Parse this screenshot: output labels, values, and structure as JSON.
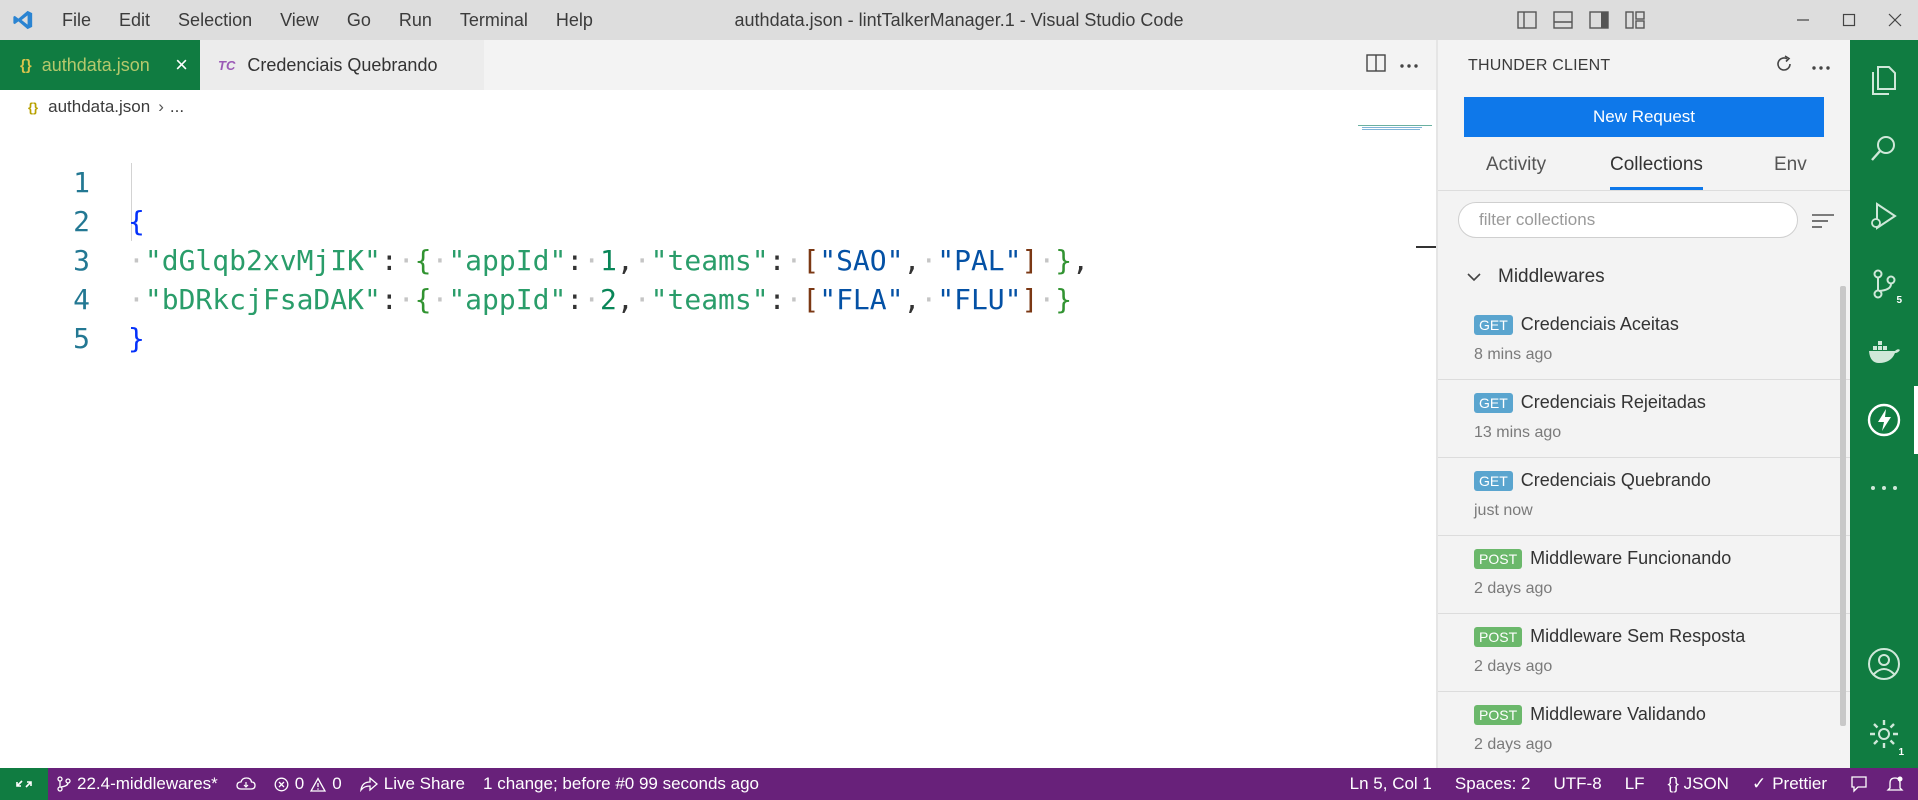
{
  "titlebar": {
    "menu": [
      "File",
      "Edit",
      "Selection",
      "View",
      "Go",
      "Run",
      "Terminal",
      "Help"
    ],
    "window_title": "authdata.json - lintTalkerManager.1 - Visual Studio Code"
  },
  "tabs": [
    {
      "label": "authdata.json",
      "icon": "{}",
      "active": true
    },
    {
      "label": "Credenciais Quebrando",
      "icon": "TC",
      "active": false
    }
  ],
  "breadcrumb": {
    "icon": "{}",
    "file": "authdata.json",
    "rest": "..."
  },
  "editor": {
    "line_numbers": [
      "1",
      "2",
      "3",
      "4",
      "5"
    ],
    "line2": {
      "key": "\"dGlqb2xvMjIK\"",
      "app_key": "\"appId\"",
      "app_val": "1",
      "teams_key": "\"teams\"",
      "team_a": "\"SAO\"",
      "team_b": "\"PAL\""
    },
    "line3": {
      "key": "\"bDRkcjFsaDAK\"",
      "app_key": "\"appId\"",
      "app_val": "2",
      "teams_key": "\"teams\"",
      "team_a": "\"FLA\"",
      "team_b": "\"FLU\""
    }
  },
  "thunder": {
    "title": "THUNDER CLIENT",
    "new_request": "New Request",
    "tabs": {
      "activity": "Activity",
      "collections": "Collections",
      "env": "Env"
    },
    "filter_placeholder": "filter collections",
    "folder": "Middlewares",
    "requests": [
      {
        "method": "GET",
        "name": "Credenciais Aceitas",
        "time": "8 mins ago"
      },
      {
        "method": "GET",
        "name": "Credenciais Rejeitadas",
        "time": "13 mins ago"
      },
      {
        "method": "GET",
        "name": "Credenciais Quebrando",
        "time": "just now"
      },
      {
        "method": "POST",
        "name": "Middleware Funcionando",
        "time": "2 days ago"
      },
      {
        "method": "POST",
        "name": "Middleware Sem Resposta",
        "time": "2 days ago"
      },
      {
        "method": "POST",
        "name": "Middleware Validando",
        "time": "2 days ago"
      }
    ]
  },
  "activity_bar": {
    "scm_badge": "5",
    "settings_badge": "1"
  },
  "statusbar": {
    "branch": "22.4-middlewares*",
    "errors": "0",
    "warnings": "0",
    "live_share": "Live Share",
    "change_info": "1 change; before #0  99 seconds ago",
    "position": "Ln 5, Col 1",
    "spaces": "Spaces: 2",
    "encoding": "UTF-8",
    "eol": "LF",
    "language": "{} JSON",
    "prettier": "Prettier"
  },
  "colors": {
    "accent": "#107c41",
    "statusbar": "#68217a",
    "button": "#0e78ea"
  }
}
